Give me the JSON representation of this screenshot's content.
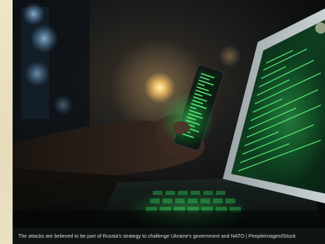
{
  "caption": {
    "text": "The attacks are believed to be part of Russia's strategy to challenge Ukraine's government and NATO | PeopleImages/iStock"
  }
}
